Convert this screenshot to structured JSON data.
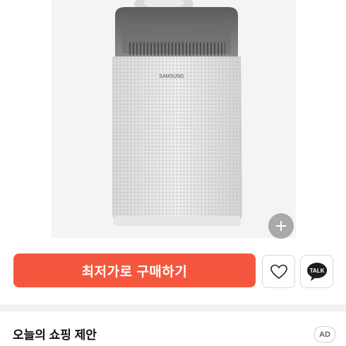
{
  "product": {
    "image_alt": "Samsung air purifier",
    "brand_text": "SAMSUNG"
  },
  "actions": {
    "buy_label": "최저가로 구매하기",
    "buy_color": "#f4573d",
    "wish_icon": "heart-icon",
    "talk_icon": "talk-bubble-icon",
    "talk_label": "TALK",
    "zoom_icon": "plus-icon"
  },
  "section": {
    "title": "오늘의 쇼핑 제안",
    "ad_label": "AD"
  }
}
